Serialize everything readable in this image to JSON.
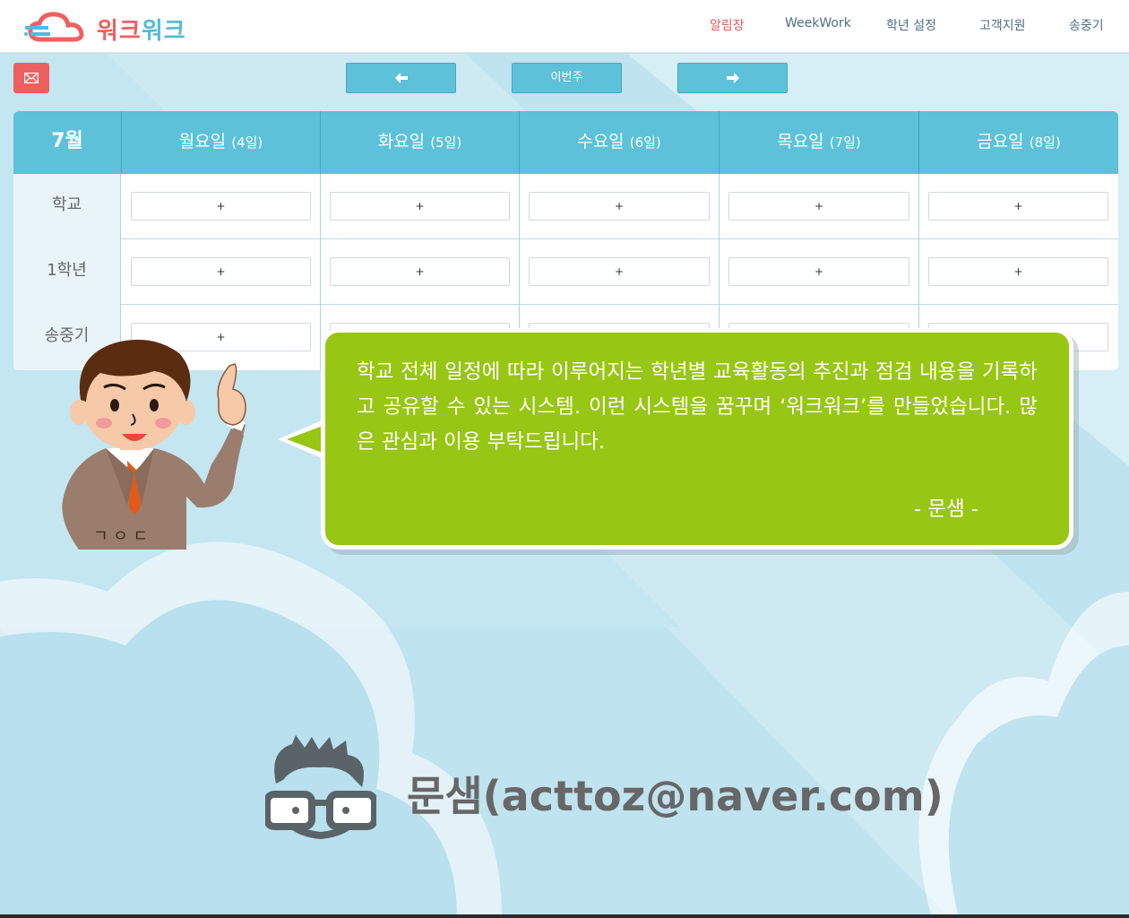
{
  "header": {
    "logo_text_a": "워크",
    "logo_text_b": "워크",
    "nav": [
      "알림장",
      "WeekWork",
      "학년 설정",
      "고객지원",
      "송중기"
    ],
    "active_index": 0
  },
  "toolbar": {
    "prev_icon": "arrow-left-icon",
    "this_week_label": "이번주",
    "next_icon": "arrow-right-icon",
    "mail_icon": "envelope-icon"
  },
  "schedule": {
    "month": "7월",
    "days": [
      {
        "name": "월요일",
        "date": "(4일)"
      },
      {
        "name": "화요일",
        "date": "(5일)"
      },
      {
        "name": "수요일",
        "date": "(6일)"
      },
      {
        "name": "목요일",
        "date": "(7일)"
      },
      {
        "name": "금요일",
        "date": "(8일)"
      }
    ],
    "rows": [
      {
        "label": "학교"
      },
      {
        "label": "1학년"
      },
      {
        "label": "송중기"
      }
    ],
    "add_label": "+"
  },
  "bubble": {
    "text": "학교 전체 일정에 따라 이루어지는 학년별 교육활동의 추진과 점검 내용을 기록하고 공유할 수 있는 시스템. 이런 시스템을 꿈꾸며 ‘워크워크’를 만들었습니다. 많은 관심과 이용 부탁드립니다.",
    "sign": "- 문샘 -"
  },
  "contact": "문샘(acttoz@naver.com)",
  "colors": {
    "accent": "#5cc1d9",
    "red": "#ee5f5f",
    "bubble": "#97c614",
    "active_nav": "#e25b5b"
  }
}
